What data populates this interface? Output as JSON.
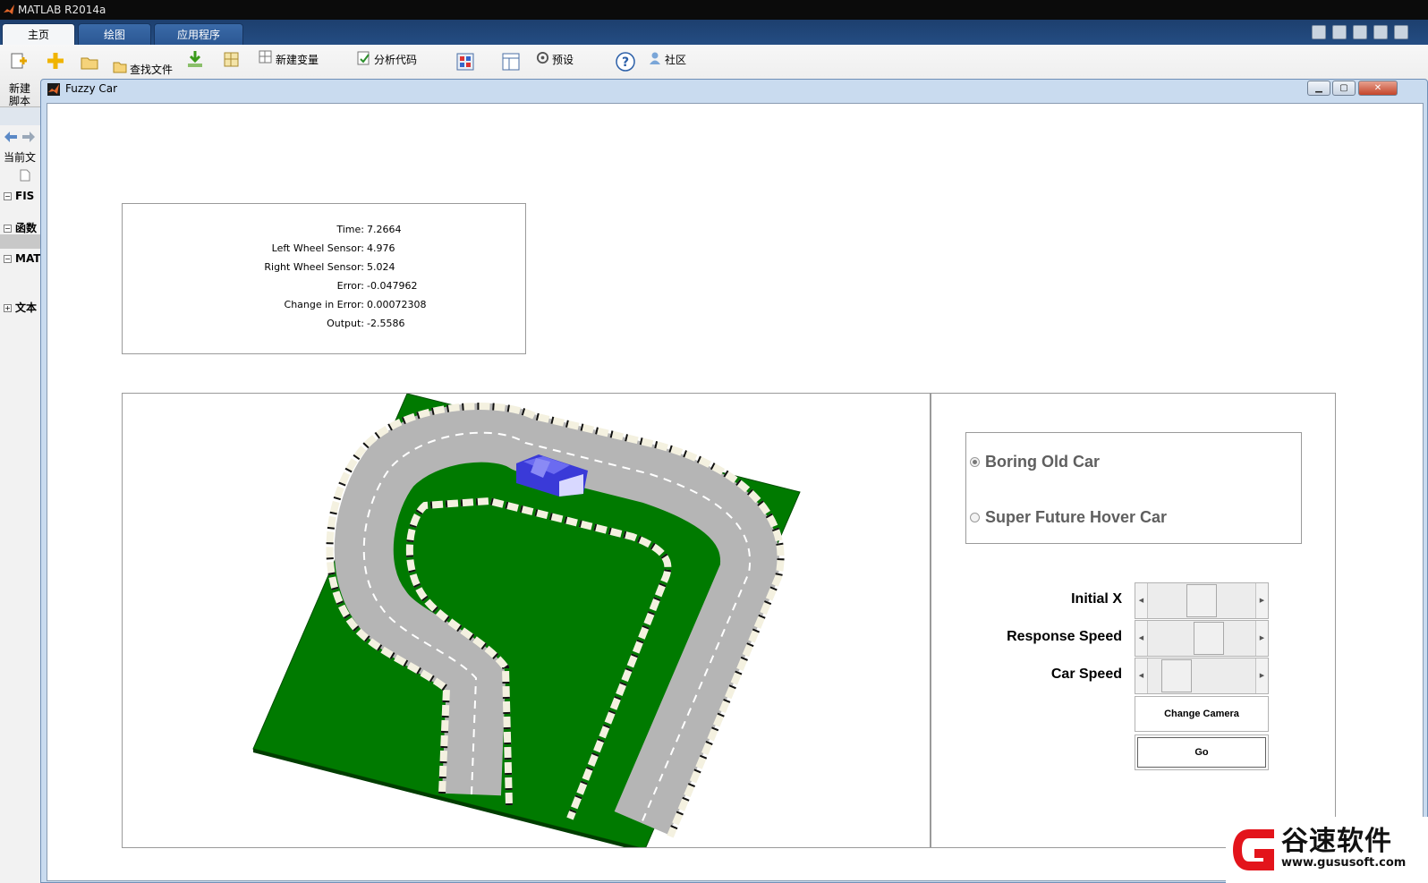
{
  "matlab": {
    "title": "MATLAB R2014a",
    "tabs": [
      {
        "label": "主页"
      },
      {
        "label": "绘图"
      },
      {
        "label": "应用程序"
      }
    ],
    "toolstrip": {
      "new_script_line1": "新建",
      "new_script_line2": "脚本",
      "find_files": "查找文件",
      "new_variable": "新建变量",
      "analyze_code": "分析代码",
      "preferences": "预设",
      "community": "社区"
    },
    "sidebar": {
      "current_folder": "当前文",
      "groups": [
        {
          "toggle": "−",
          "label": "FIS"
        },
        {
          "toggle": "−",
          "label": "函数"
        },
        {
          "toggle": "−",
          "label": "MAT"
        },
        {
          "toggle": "+",
          "label": "文本"
        }
      ]
    }
  },
  "figure": {
    "title": "Fuzzy Car",
    "info": {
      "rows": [
        {
          "label": "Time:",
          "value": "7.2664"
        },
        {
          "label": "Left Wheel Sensor:",
          "value": "4.976"
        },
        {
          "label": "Right Wheel Sensor:",
          "value": "5.024"
        },
        {
          "label": "Error:",
          "value": "-0.047962"
        },
        {
          "label": "Change in Error:",
          "value": "0.00072308"
        },
        {
          "label": "Output:",
          "value": "-2.5586"
        }
      ]
    },
    "controls": {
      "car_options": [
        {
          "label": "Boring Old Car",
          "selected": true
        },
        {
          "label": "Super Future Hover Car",
          "selected": false
        }
      ],
      "sliders": [
        {
          "label": "Initial X",
          "value_fraction": 0.5
        },
        {
          "label": "Response Speed",
          "value_fraction": 0.59
        },
        {
          "label": "Car Speed",
          "value_fraction": 0.17
        }
      ],
      "change_camera_label": "Change Camera",
      "go_label": "Go"
    },
    "scene_colors": {
      "grass": "#007a00",
      "road": "#b5b5b5",
      "car": "#3a3ad8"
    }
  },
  "watermark": {
    "text": "谷速软件",
    "url": "www.gususoft.com"
  }
}
